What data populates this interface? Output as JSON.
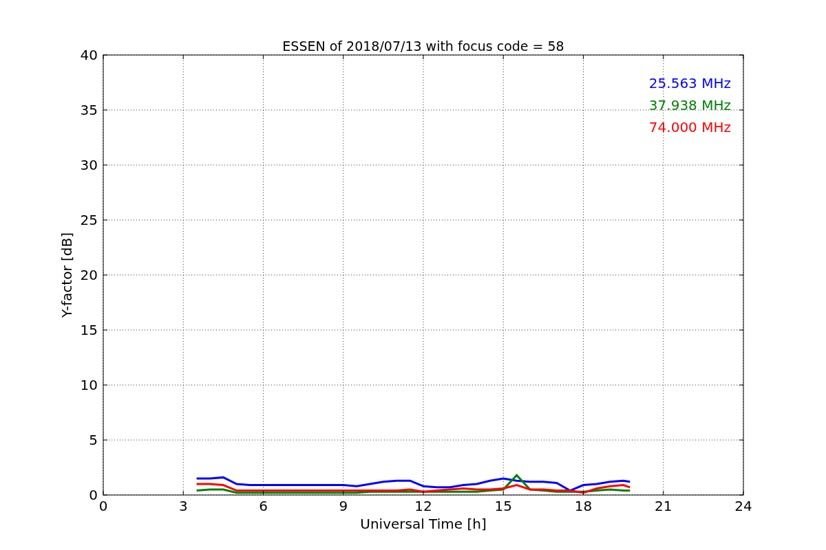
{
  "chart_data": {
    "type": "line",
    "title": "ESSEN of 2018/07/13 with focus code = 58",
    "xlabel": "Universal Time [h]",
    "ylabel": "Y-factor [dB]",
    "x": [
      3.5,
      4,
      4.5,
      5,
      5.5,
      6,
      6.5,
      7,
      7.5,
      8,
      8.5,
      9,
      9.5,
      10,
      10.5,
      11,
      11.5,
      12,
      12.5,
      13,
      13.5,
      14,
      14.5,
      15,
      15.5,
      16,
      16.5,
      17,
      17.5,
      18,
      18.5,
      19,
      19.5,
      19.75
    ],
    "series": [
      {
        "name": "25.563 MHz",
        "color": "#0000ff",
        "values": [
          1.5,
          1.5,
          1.6,
          1.0,
          0.9,
          0.9,
          0.9,
          0.9,
          0.9,
          0.9,
          0.9,
          0.9,
          0.8,
          1.0,
          1.2,
          1.3,
          1.3,
          0.8,
          0.7,
          0.7,
          0.9,
          1.0,
          1.3,
          1.5,
          1.3,
          1.2,
          1.2,
          1.1,
          0.4,
          0.9,
          1.0,
          1.2,
          1.3,
          1.2
        ]
      },
      {
        "name": "37.938 MHz",
        "color": "#008000",
        "values": [
          0.4,
          0.5,
          0.5,
          0.2,
          0.2,
          0.2,
          0.2,
          0.2,
          0.2,
          0.2,
          0.2,
          0.2,
          0.2,
          0.3,
          0.3,
          0.3,
          0.3,
          0.3,
          0.3,
          0.3,
          0.3,
          0.3,
          0.4,
          0.5,
          1.8,
          0.5,
          0.4,
          0.3,
          0.3,
          0.3,
          0.4,
          0.5,
          0.4,
          0.4
        ]
      },
      {
        "name": "74.000 MHz",
        "color": "#ff0000",
        "values": [
          1.0,
          1.0,
          0.9,
          0.4,
          0.4,
          0.4,
          0.4,
          0.4,
          0.4,
          0.4,
          0.4,
          0.4,
          0.4,
          0.4,
          0.4,
          0.4,
          0.5,
          0.3,
          0.4,
          0.5,
          0.6,
          0.5,
          0.5,
          0.6,
          0.9,
          0.5,
          0.5,
          0.4,
          0.4,
          0.2,
          0.6,
          0.8,
          0.9,
          0.7
        ]
      }
    ],
    "xlim": [
      0,
      24
    ],
    "ylim": [
      0,
      40
    ],
    "xticks": [
      0,
      3,
      6,
      9,
      12,
      15,
      18,
      21,
      24
    ],
    "yticks": [
      0,
      5,
      10,
      15,
      20,
      25,
      30,
      35,
      40
    ],
    "grid": true
  }
}
